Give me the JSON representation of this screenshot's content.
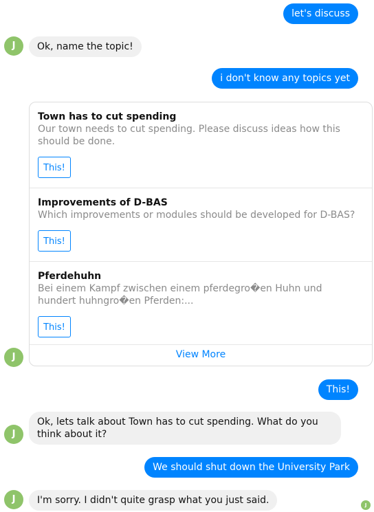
{
  "messages": {
    "m1_user": "let's discuss",
    "m2_bot": "Ok, name the topic!",
    "m3_user": "i don't know any topics yet",
    "m5_user": "This!",
    "m6_bot": "Ok, lets talk about Town has to cut spending. What do you think about it?",
    "m7_user": "We should shut down the University Park",
    "m8_bot": "I'm sorry. I didn't quite grasp what you just said."
  },
  "avatar": {
    "initial": "J",
    "color": "#8fc46a"
  },
  "topic_card": {
    "items": [
      {
        "title": "Town has to cut spending",
        "description": "Our town needs to cut spending. Please discuss ideas how this should be done.",
        "button": "This!"
      },
      {
        "title": "Improvements of D-BAS",
        "description": "Which improvements or modules should be developed for D-BAS?",
        "button": "This!"
      },
      {
        "title": "Pferdehuhn",
        "description": "Bei einem Kampf zwischen einem pferdegro�en Huhn und hundert huhngro�en Pferden:...",
        "button": "This!"
      }
    ],
    "view_more": "View More"
  },
  "colors": {
    "user_bubble": "#0084ff",
    "bot_bubble": "#f0f0f0",
    "accent": "#0084ff"
  }
}
